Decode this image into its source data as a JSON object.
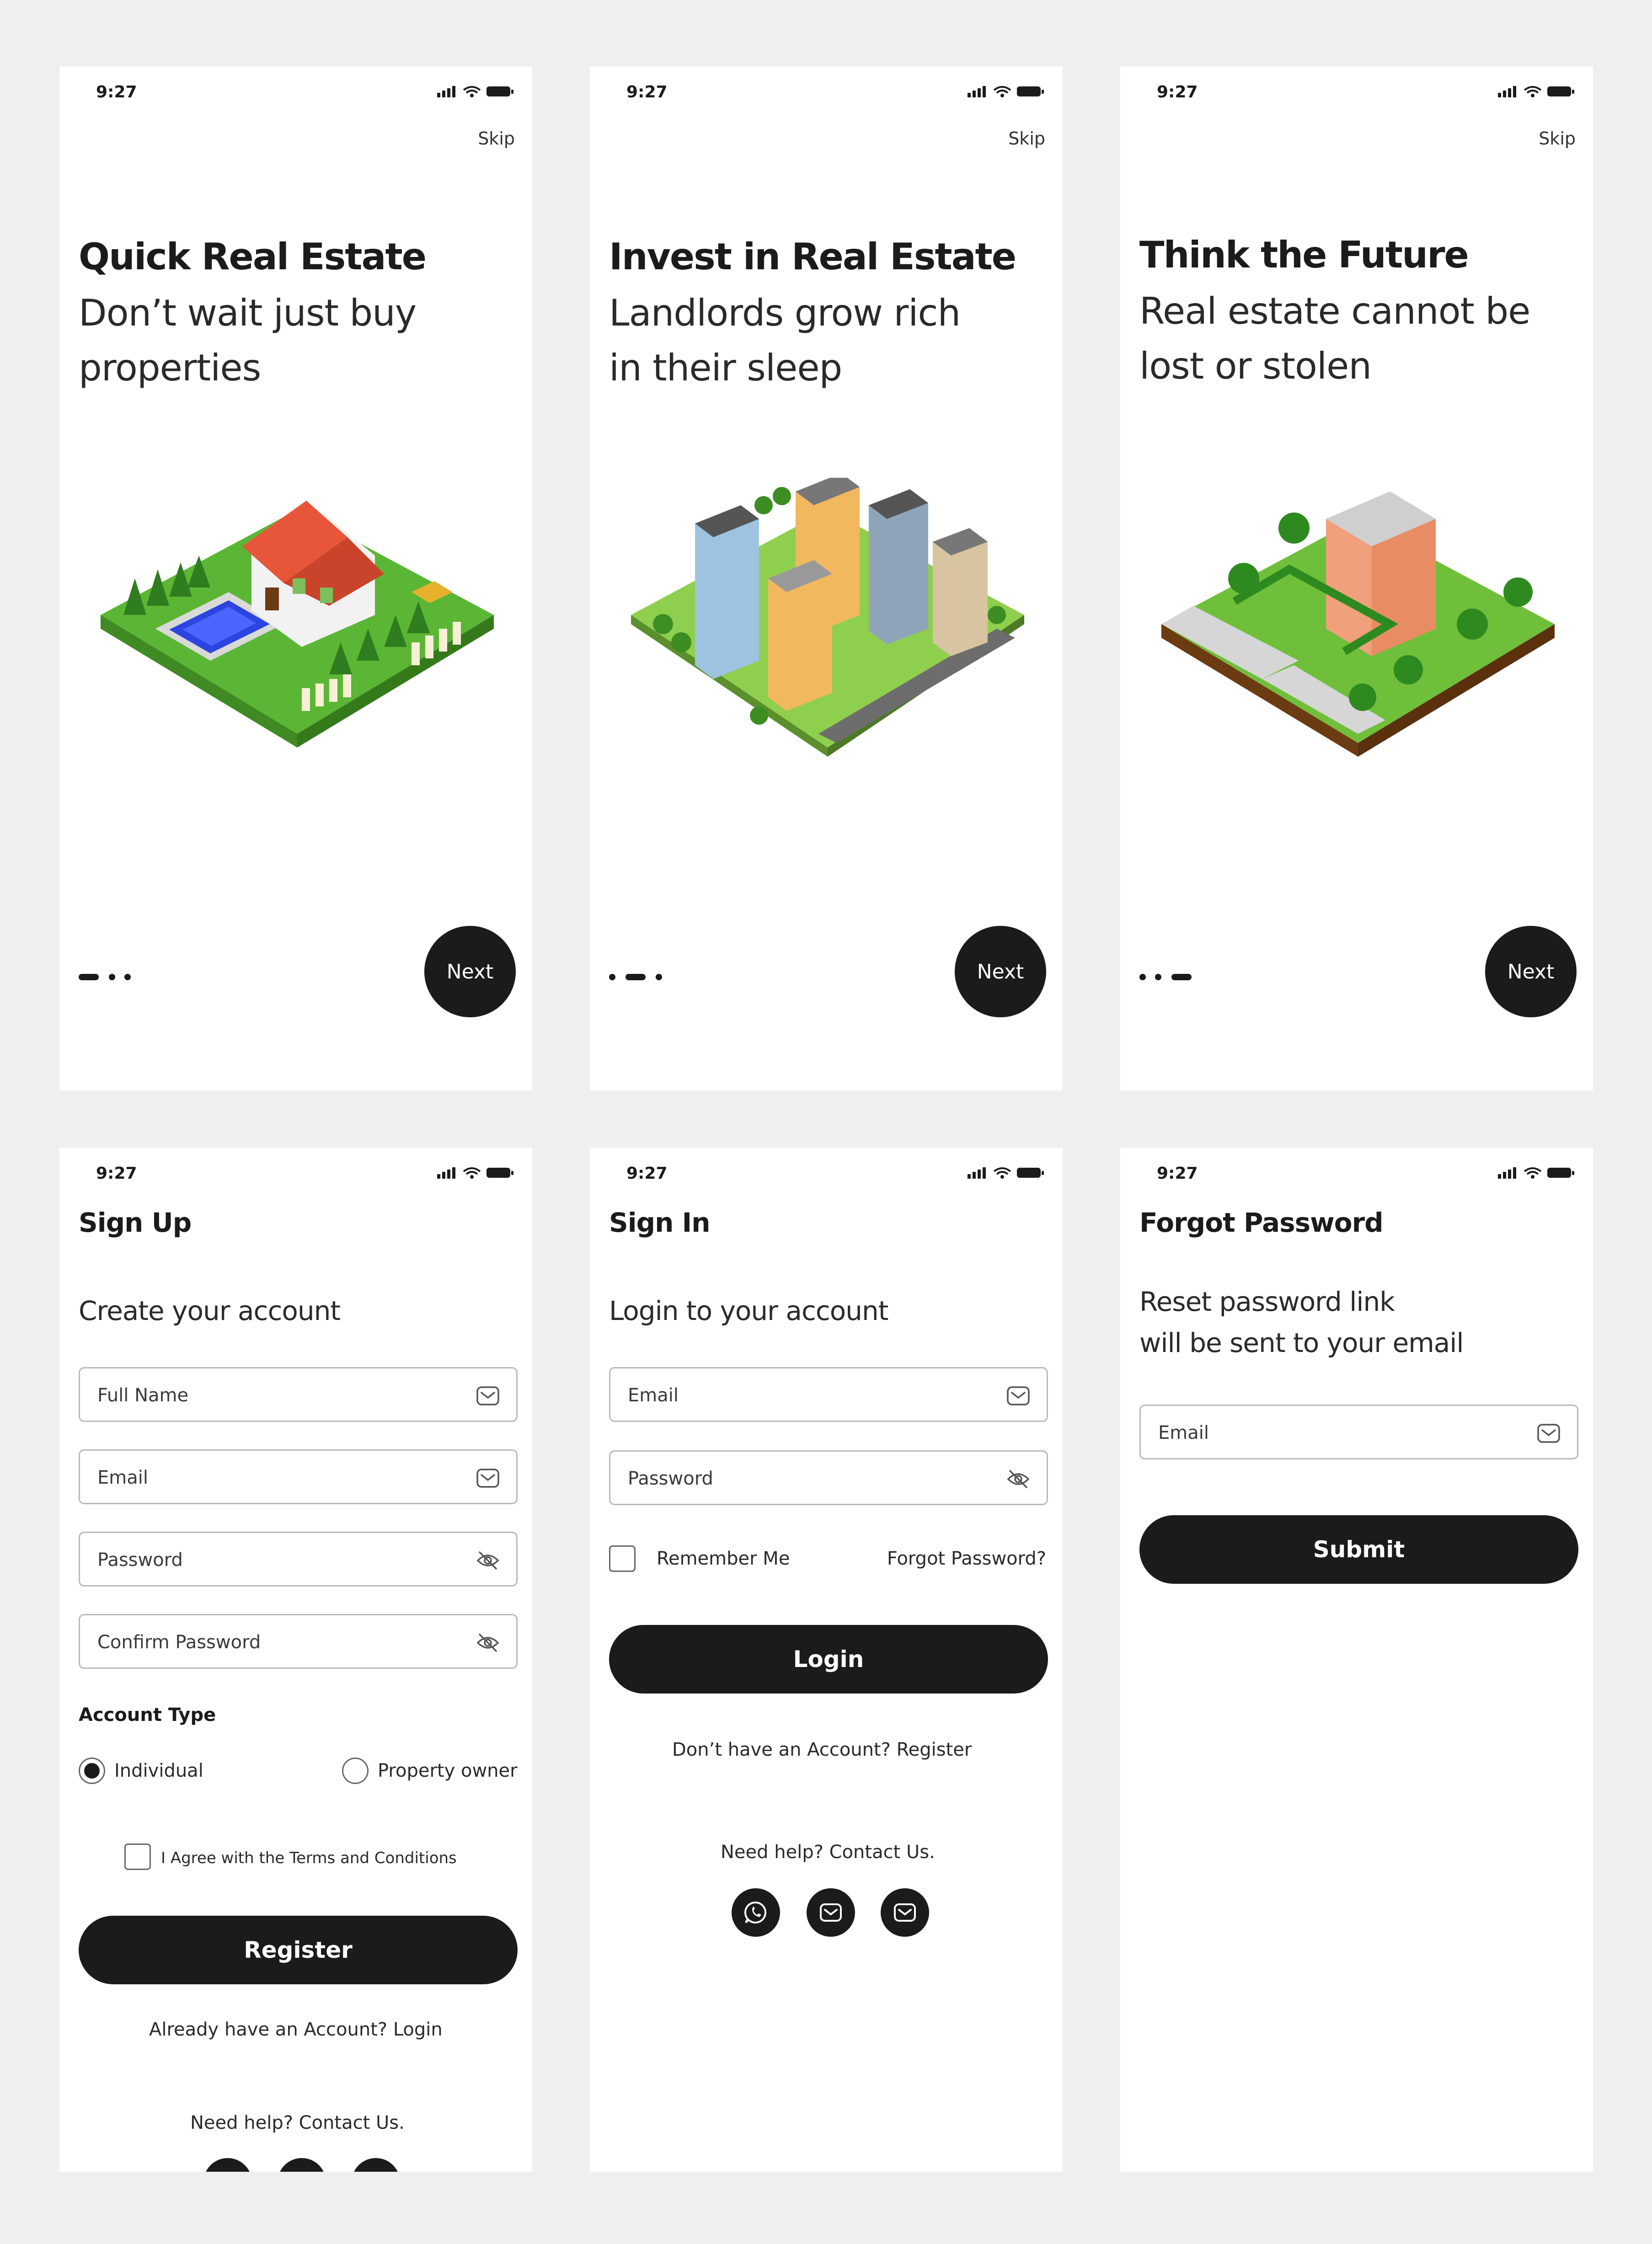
{
  "status": {
    "time": "9:27"
  },
  "onboarding": [
    {
      "skip": "Skip",
      "title": "Quick Real Estate",
      "subtitle_line1": "Don’t wait just buy",
      "subtitle_line2": "properties",
      "next": "Next",
      "active_dot": 0
    },
    {
      "skip": "Skip",
      "title": "Invest in Real Estate",
      "subtitle_line1": "Landlords grow rich",
      "subtitle_line2": "in their sleep",
      "next": "Next",
      "active_dot": 1
    },
    {
      "skip": "Skip",
      "title": "Think the Future",
      "subtitle_line1": "Real estate cannot be",
      "subtitle_line2": "lost or stolen",
      "next": "Next",
      "active_dot": 2
    }
  ],
  "signup": {
    "title": "Sign Up",
    "subtitle": "Create your account",
    "fields": [
      "Full Name",
      "Email",
      "Password",
      "Confirm Password"
    ],
    "account_type_label": "Account Type",
    "account_types": [
      "Individual",
      "Property owner"
    ],
    "selected_account_type": "Individual",
    "terms": "I Agree with the Terms and Conditions",
    "register": "Register",
    "already": "Already have an Account? Login",
    "help": "Need help? Contact Us."
  },
  "signin": {
    "title": "Sign In",
    "subtitle": "Login to your account",
    "fields": [
      "Email",
      "Password"
    ],
    "remember": "Remember Me",
    "forgot": "Forgot Password?",
    "login": "Login",
    "register_prompt": "Don’t have an Account? Register",
    "help": "Need help? Contact Us.",
    "socials": [
      "whatsapp-icon",
      "mail-icon",
      "mail-icon"
    ]
  },
  "forgot": {
    "title": "Forgot Password",
    "subtitle_line1": "Reset password link",
    "subtitle_line2": "will be sent to your email",
    "email": "Email",
    "submit": "Submit"
  },
  "colors": {
    "background": "#efefef",
    "card": "#ffffff",
    "primary": "#1b1b1b",
    "border": "#b9b9b9"
  }
}
